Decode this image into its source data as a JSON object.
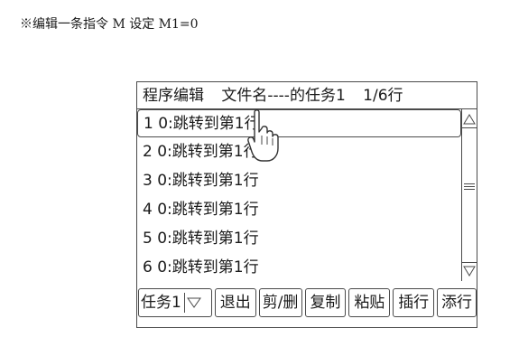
{
  "caption": "※编辑一条指令 M 设定 M1=0",
  "header": {
    "title": "程序编辑",
    "file_label": "文件名----的任务1",
    "page": "1/6行"
  },
  "rows": [
    {
      "num": "1",
      "text": "0:跳转到第1行"
    },
    {
      "num": "2",
      "text": "0:跳转到第1行"
    },
    {
      "num": "3",
      "text": "0:跳转到第1行"
    },
    {
      "num": "4",
      "text": "0:跳转到第1行"
    },
    {
      "num": "5",
      "text": "0:跳转到第1行"
    },
    {
      "num": "6",
      "text": "0:跳转到第1行"
    }
  ],
  "toolbar": {
    "task": "任务1",
    "exit": "退出",
    "cut_delete": "剪/删",
    "copy": "复制",
    "paste": "粘贴",
    "insert": "插行",
    "append": "添行"
  },
  "icons": {
    "scroll_up": "triangle-up-icon",
    "scroll_down": "triangle-down-icon",
    "dropdown": "triangle-down-icon",
    "pointer": "hand-pointer-icon"
  }
}
